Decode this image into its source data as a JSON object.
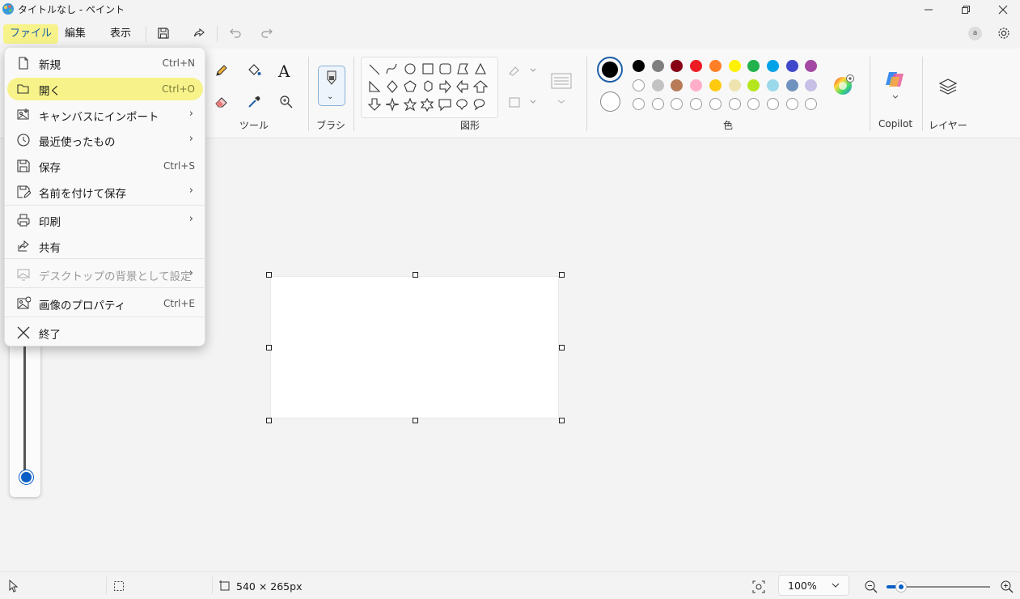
{
  "window": {
    "title": "タイトルなし - ペイント"
  },
  "menubar": {
    "file": "ファイル",
    "edit": "編集",
    "view": "表示"
  },
  "ribbon": {
    "groups": {
      "tools": "ツール",
      "brush": "ブラシ",
      "shapes": "図形",
      "colors": "色",
      "copilot": "Copilot",
      "layers": "レイヤー"
    },
    "palette_row1": [
      "#000000",
      "#7f7f7f",
      "#880015",
      "#ed1c24",
      "#ff7f27",
      "#fff200",
      "#22b14c",
      "#00a2e8",
      "#3f48cc",
      "#a349a4"
    ],
    "palette_row2": [
      "#ffffff",
      "#c3c3c3",
      "#b97a57",
      "#ffaec9",
      "#ffc90e",
      "#efe4b0",
      "#b5e61d",
      "#99d9ea",
      "#7092be",
      "#c8bfe7"
    ],
    "active_color_1": "#000000",
    "active_color_2": "#ffffff"
  },
  "file_menu": {
    "items": [
      {
        "label": "新規",
        "shortcut": "Ctrl+N",
        "icon": "new-file-icon"
      },
      {
        "label": "開く",
        "shortcut": "Ctrl+O",
        "icon": "folder-open-icon"
      },
      {
        "label": "キャンバスにインポート",
        "icon": "import-icon"
      },
      {
        "label": "最近使ったもの",
        "icon": "clock-icon"
      },
      {
        "label": "保存",
        "shortcut": "Ctrl+S",
        "icon": "save-icon"
      },
      {
        "label": "名前を付けて保存",
        "icon": "save-as-icon"
      },
      {
        "label": "印刷",
        "icon": "printer-icon"
      },
      {
        "label": "共有",
        "icon": "share-icon"
      },
      {
        "label": "デスクトップの背景として設定",
        "icon": "desktop-background-icon"
      },
      {
        "label": "画像のプロパティ",
        "shortcut": "Ctrl+E",
        "icon": "image-properties-icon"
      },
      {
        "label": "終了",
        "icon": "close-icon"
      }
    ]
  },
  "statusbar": {
    "canvas_size": "540 × 265px",
    "zoom": "100%",
    "zoom_level": 0.1
  }
}
